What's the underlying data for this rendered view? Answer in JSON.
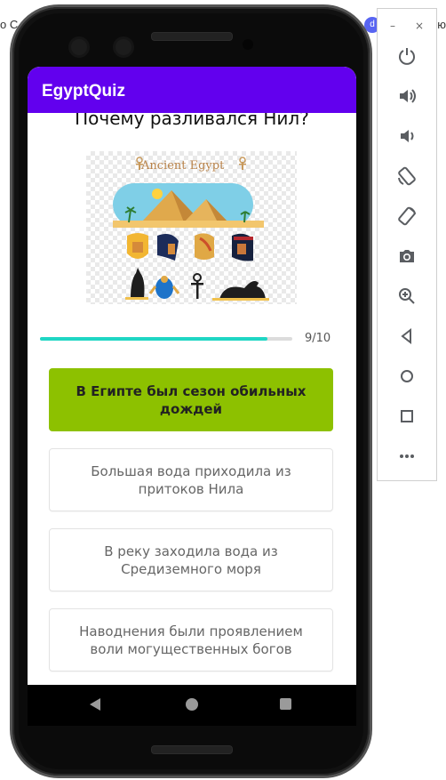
{
  "background": {
    "left_text": "о С",
    "right_text": "ю"
  },
  "app": {
    "title": "EgyptQuiz",
    "accent": "#6200ee"
  },
  "quiz": {
    "question": "Почему разливался Нил?",
    "progress": {
      "current": 9,
      "total": 10,
      "label": "9/10",
      "fraction": 0.9
    },
    "image": {
      "caption": "Ancient  Egypt"
    },
    "answers": [
      {
        "text": "В Египте был сезон обильных дождей",
        "state": "correct"
      },
      {
        "text": "Большая вода приходила из притоков Нила",
        "state": "default"
      },
      {
        "text": "В реку заходила вода из Средиземного моря",
        "state": "default"
      },
      {
        "text": "Наводнения были проявлением воли могущественных богов",
        "state": "default"
      }
    ]
  },
  "navbar": {
    "icons": [
      "back-icon",
      "home-icon",
      "recents-icon"
    ]
  },
  "emulator_toolbar": {
    "minimize": "–",
    "close": "×",
    "buttons": [
      "power-icon",
      "volume-up-icon",
      "volume-down-icon",
      "rotate-left-icon",
      "rotate-right-icon",
      "camera-icon",
      "zoom-icon",
      "back-icon",
      "home-icon",
      "overview-icon",
      "more-icon"
    ]
  },
  "colors": {
    "correct": "#8dc100",
    "progress": "#1fd6c4"
  }
}
